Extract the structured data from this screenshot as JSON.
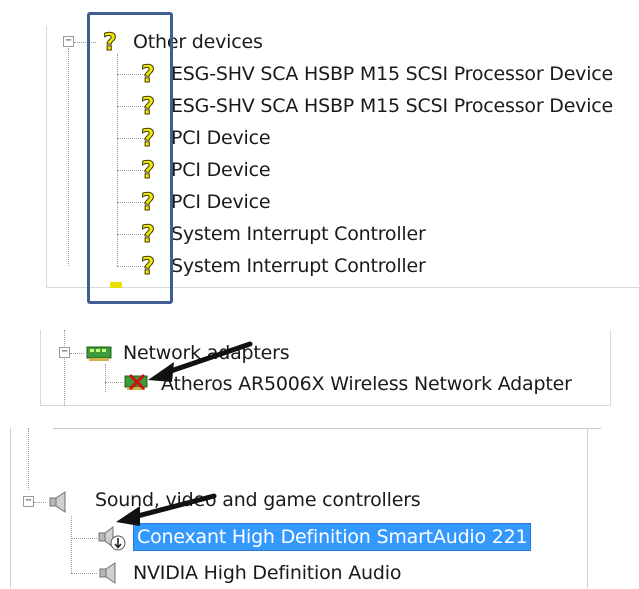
{
  "panel1": {
    "category": {
      "label": "Other devices",
      "icon": "unknown-device-icon",
      "expander": "−"
    },
    "devices": [
      {
        "label": "ESG-SHV SCA HSBP M15 SCSI Processor Device",
        "icon": "unknown-device-icon"
      },
      {
        "label": "ESG-SHV SCA HSBP M15 SCSI Processor Device",
        "icon": "unknown-device-icon"
      },
      {
        "label": "PCI Device",
        "icon": "unknown-device-icon"
      },
      {
        "label": "PCI Device",
        "icon": "unknown-device-icon"
      },
      {
        "label": "PCI Device",
        "icon": "unknown-device-icon"
      },
      {
        "label": "System Interrupt Controller",
        "icon": "unknown-device-icon"
      },
      {
        "label": "System Interrupt Controller",
        "icon": "unknown-device-icon"
      }
    ]
  },
  "panel2": {
    "category": {
      "label": "Network adapters",
      "icon": "network-adapter-icon",
      "expander": "−"
    },
    "devices": [
      {
        "label": "Atheros AR5006X Wireless Network Adapter",
        "icon": "disabled-network-adapter-icon"
      }
    ]
  },
  "panel3": {
    "category": {
      "label": "Sound, video and game controllers",
      "icon": "speaker-icon",
      "expander": "−"
    },
    "devices": [
      {
        "label": "Conexant High Definition SmartAudio 221",
        "icon": "speaker-disabled-icon",
        "selected": true
      },
      {
        "label": "NVIDIA High Definition Audio",
        "icon": "speaker-icon",
        "selected": false
      }
    ]
  },
  "colors": {
    "selection": "#3399ff",
    "highlight_box": "#3e5f8f",
    "warning_yellow": "#f5e800"
  }
}
